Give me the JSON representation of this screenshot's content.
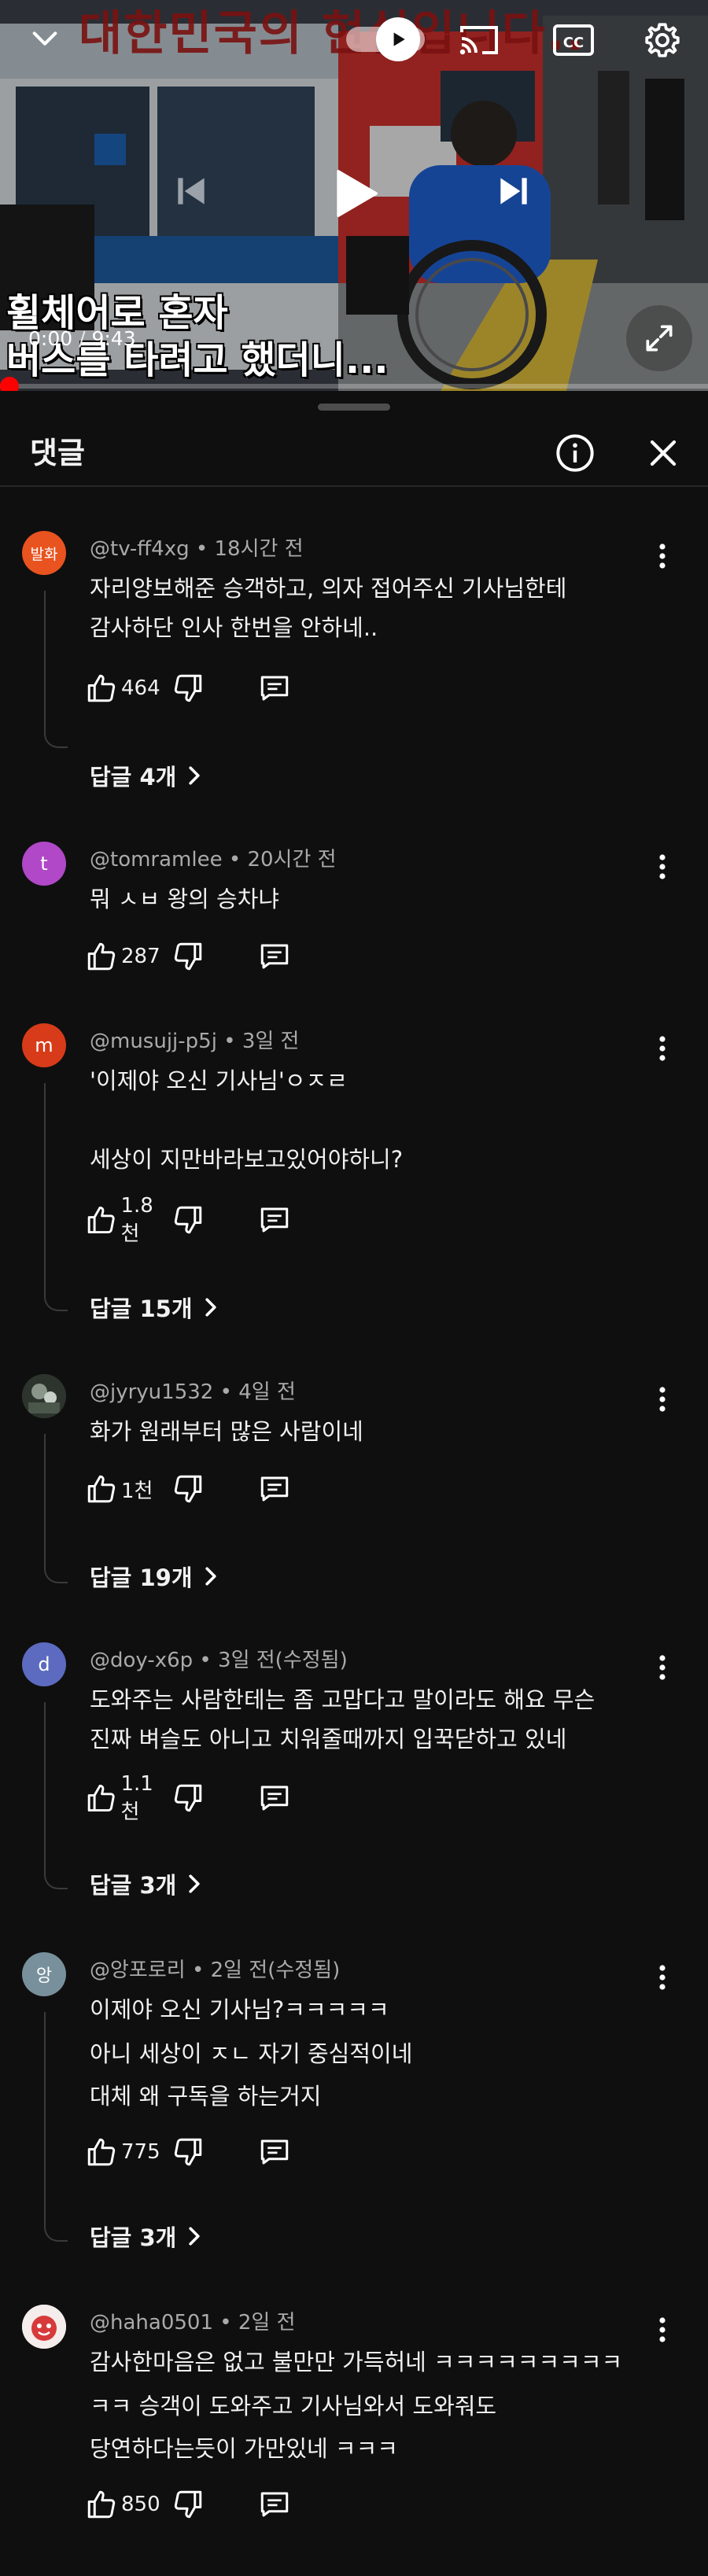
{
  "player": {
    "overlay_top_text": "대한민국의 현실입니다..",
    "caption_line1": "휠체어로 혼자",
    "caption_line2": "버스를 타려고 했더니...",
    "time_current": "0:00",
    "time_separator": " / ",
    "time_total": "9:43",
    "progress_fraction": 0.0,
    "accent_color": "#ff0000",
    "icons": [
      "chevron-down-icon",
      "autoplay-toggle-icon",
      "cast-icon",
      "cc-icon",
      "settings-gear-icon",
      "skip-previous-icon",
      "play-icon",
      "skip-next-icon",
      "fullscreen-icon"
    ]
  },
  "panel": {
    "title": "댓글",
    "icons": [
      "info-icon",
      "close-icon"
    ]
  },
  "comments": [
    {
      "author": "@tv-ff4xg",
      "time": "18시간 전",
      "avatar_text": "발화",
      "avatar_color": "#e8531f",
      "lines": [
        "자리양보해준 승객하고, 의자 접어주신 기사님한테",
        "감사하단 인사 한번을 안하네.."
      ],
      "likes": "464",
      "replies": "답글 4개"
    },
    {
      "author": "@tomramlee",
      "time": "20시간 전",
      "avatar_text": "t",
      "avatar_color": "#b048c8",
      "lines": [
        "뭐 ㅅㅂ 왕의 승차냐"
      ],
      "likes": "287",
      "replies": ""
    },
    {
      "author": "@musujj-p5j",
      "time": "3일 전",
      "avatar_text": "m",
      "avatar_color": "#d73b1a",
      "lines": [
        "'이제야 오신 기사님'ㅇㅈㄹ",
        "",
        "세상이 지만바라보고있어야하니?"
      ],
      "likes": "1.8천",
      "replies": "답글 15개"
    },
    {
      "author": "@jyryu1532",
      "time": "4일 전",
      "avatar_text": "",
      "avatar_color": "#3a3f3a",
      "lines": [
        "화가 원래부터 많은 사람이네"
      ],
      "likes": "1천",
      "replies": "답글 19개"
    },
    {
      "author": "@doy-x6p",
      "time": "3일 전(수정됨)",
      "avatar_text": "d",
      "avatar_color": "#5c6bc0",
      "lines": [
        "도와주는 사람한테는 좀 고맙다고 말이라도 해요 무슨",
        "진짜 벼슬도 아니고 치워줄때까지 입꾹닫하고 있네"
      ],
      "likes": "1.1천",
      "replies": "답글 3개"
    },
    {
      "author": "@앙포로리",
      "time": "2일 전(수정됨)",
      "avatar_text": "앙",
      "avatar_color": "#78909c",
      "lines": [
        "이제야 오신 기사님?ㅋㅋㅋㅋㅋ",
        "아니 세상이 ㅈㄴ 자기 중심적이네",
        "대체 왜 구독을 하는거지"
      ],
      "likes": "775",
      "replies": "답글 3개"
    },
    {
      "author": "@haha0501",
      "time": "2일 전",
      "avatar_text": "",
      "avatar_color": "#f3e6e6",
      "lines": [
        "감사한마음은 없고 불만만 가득허네 ㅋㅋㅋㅋㅋㅋㅋㅋㅋ",
        "ㅋㅋ 승객이 도와주고 기사님와서 도와줘도",
        "당연하다는듯이 가만있네 ㅋㅋㅋ"
      ],
      "likes": "850",
      "replies": ""
    }
  ],
  "comment_icons": [
    "thumb-up-icon",
    "thumb-down-icon",
    "reply-icon",
    "more-vert-icon",
    "chevron-right-icon"
  ]
}
